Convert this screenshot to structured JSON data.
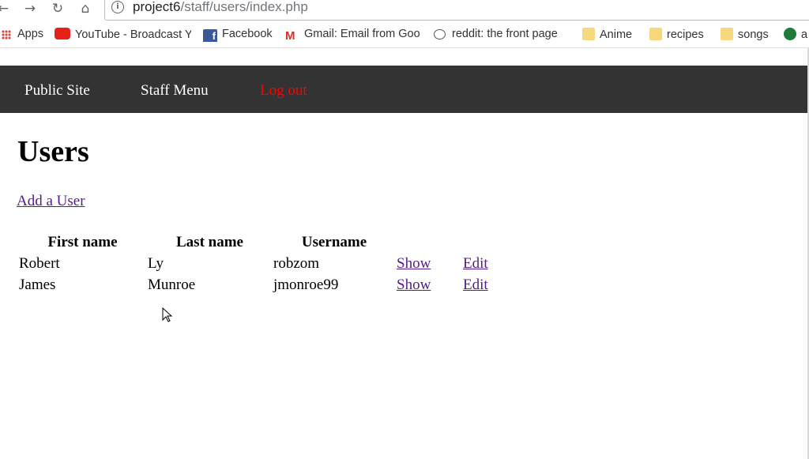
{
  "browser": {
    "url_host": "project6",
    "url_path": "/staff/users/index.php",
    "bookmarks": [
      {
        "label": "Apps",
        "icon": "apps-grid-icon"
      },
      {
        "label": "YouTube - Broadcast Y",
        "icon": "youtube-icon"
      },
      {
        "label": "Facebook",
        "icon": "facebook-icon"
      },
      {
        "label": "Gmail: Email from Goo",
        "icon": "gmail-icon"
      },
      {
        "label": "reddit: the front page",
        "icon": "reddit-icon"
      },
      {
        "label": "Anime",
        "icon": "folder-icon"
      },
      {
        "label": "recipes",
        "icon": "folder-icon"
      },
      {
        "label": "songs",
        "icon": "folder-icon"
      },
      {
        "label": "a",
        "icon": "globe-icon"
      }
    ]
  },
  "site_nav": {
    "public_site": "Public Site",
    "staff_menu": "Staff Menu",
    "log_out": "Log out",
    "logout_color": "#ff0000"
  },
  "page": {
    "title": "Users",
    "add_link": "Add a User"
  },
  "table": {
    "headers": [
      "First name",
      "Last name",
      "Username"
    ],
    "rows": [
      {
        "first": "Robert",
        "last": "Ly",
        "username": "robzom",
        "show": "Show",
        "edit": "Edit"
      },
      {
        "first": "James",
        "last": "Munroe",
        "username": "jmonroe99",
        "show": "Show",
        "edit": "Edit"
      }
    ]
  }
}
